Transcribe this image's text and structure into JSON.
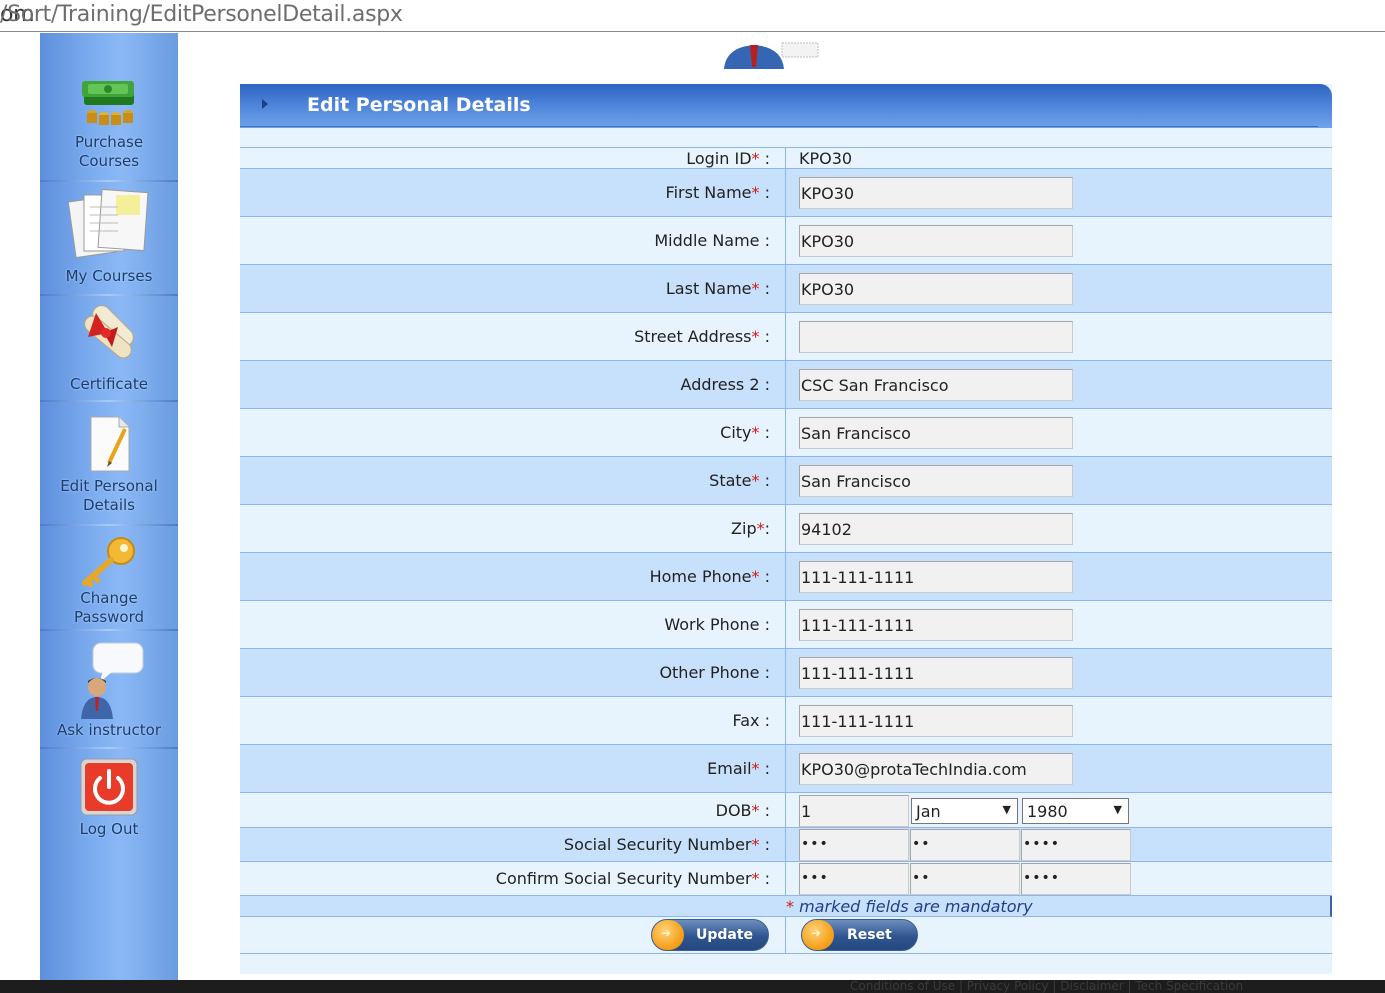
{
  "browser": {
    "url_prefix": "om",
    "url_path": "/Sort/Training/EditPersonelDetail.aspx"
  },
  "sidebar": {
    "items": [
      {
        "label_line1": "Purchase",
        "label_line2": "Courses",
        "icon": "money-stack-icon"
      },
      {
        "label_line1": "My Courses",
        "label_line2": "",
        "icon": "documents-icon"
      },
      {
        "label_line1": "Certificate",
        "label_line2": "",
        "icon": "diploma-scroll-icon"
      },
      {
        "label_line1": "Edit Personal",
        "label_line2": "Details",
        "icon": "edit-document-icon"
      },
      {
        "label_line1": "Change",
        "label_line2": "Password",
        "icon": "key-icon"
      },
      {
        "label_line1": "Ask instructor",
        "label_line2": "",
        "icon": "speech-bubble-person-icon"
      },
      {
        "label_line1": "Log Out",
        "label_line2": "",
        "icon": "power-button-icon"
      }
    ]
  },
  "form": {
    "title": "Edit Personal Details",
    "login_id_label": "Login ID",
    "login_id_value": "KPO30",
    "fields": [
      {
        "label": "First Name",
        "required": "*",
        "value": "KPO30"
      },
      {
        "label": "Middle Name",
        "required": "",
        "value": "KPO30"
      },
      {
        "label": "Last Name",
        "required": "*",
        "value": "KPO30"
      },
      {
        "label": "Street Address",
        "required": "*",
        "value": ""
      },
      {
        "label": "Address 2",
        "required": "",
        "value": "CSC San Francisco"
      },
      {
        "label": "City",
        "required": "*",
        "value": "San Francisco"
      },
      {
        "label": "State",
        "required": "*",
        "value": "San Francisco"
      },
      {
        "label": "Zip",
        "required": "*",
        "value": "94102"
      },
      {
        "label": "Home Phone",
        "required": "*",
        "value": "111-111-1111"
      },
      {
        "label": "Work Phone",
        "required": "",
        "value": "111-111-1111"
      },
      {
        "label": "Other Phone",
        "required": "",
        "value": "111-111-1111"
      },
      {
        "label": "Fax",
        "required": "",
        "value": "111-111-1111"
      },
      {
        "label": "Email",
        "required": "*",
        "value": "KPO30@protaTechIndia.com"
      }
    ],
    "dob": {
      "label": "DOB",
      "day": "1",
      "month": "Jan",
      "year": "1980"
    },
    "ssn": {
      "label": "Social Security Number",
      "part1": "•••",
      "part2": "••",
      "part3": "••••"
    },
    "ssn_confirm": {
      "label": "Confirm Social Security Number",
      "part1": "•••",
      "part2": "••",
      "part3": "••••"
    },
    "mandatory_note": "marked fields are mandatory",
    "update_label": "Update",
    "reset_label": "Reset"
  },
  "footer_text": "Conditions of Use | Privacy Policy | Disclaimer | Tech Specification",
  "colors": {
    "header_blue": "#3f75cf",
    "row_alt": "#c7e0fb",
    "row_plain": "#e8f4fd",
    "required_red": "#cc1b1b"
  }
}
